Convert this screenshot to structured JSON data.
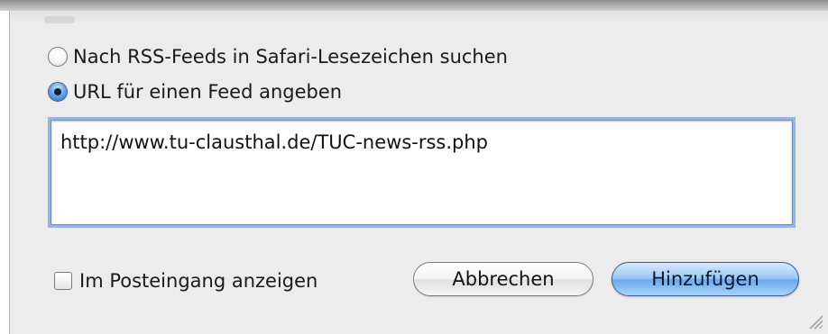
{
  "dialog": {
    "options": [
      {
        "label": "Nach RSS-Feeds in Safari-Lesezeichen suchen",
        "selected": false
      },
      {
        "label": "URL für einen Feed angeben",
        "selected": true
      }
    ],
    "url_field": {
      "value": "http://www.tu-clausthal.de/TUC-news-rss.php"
    },
    "checkbox": {
      "label": "Im Posteingang anzeigen",
      "checked": false
    },
    "buttons": {
      "cancel_label": "Abbrechen",
      "add_label": "Hinzufügen"
    }
  },
  "icons": {
    "resize_grip": "resize-grip-icon"
  },
  "colors": {
    "sheet_background": "#ececec",
    "focus_ring": "#78a4e2",
    "default_button": "#6aa8ea"
  }
}
